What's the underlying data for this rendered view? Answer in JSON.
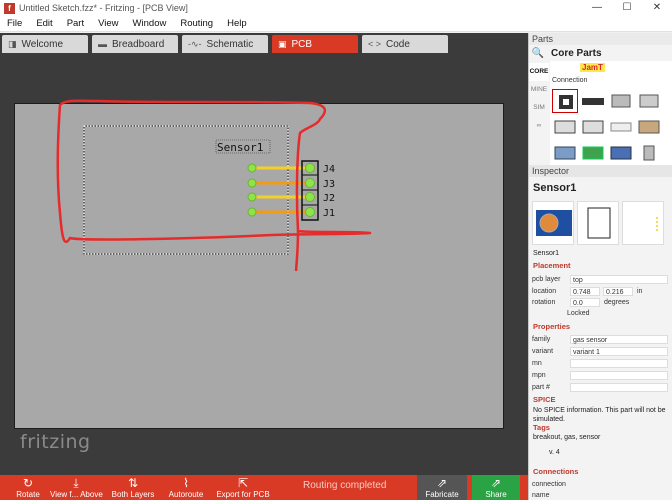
{
  "titlebar": {
    "title": "Untitled Sketch.fzz* - Fritzing - [PCB View]",
    "app_icon": "f",
    "minimize": "—",
    "maximize": "☐",
    "close": "✕"
  },
  "menu": [
    "File",
    "Edit",
    "Part",
    "View",
    "Window",
    "Routing",
    "Help"
  ],
  "tabs": [
    {
      "label": "Welcome",
      "icon": "◨",
      "active": false
    },
    {
      "label": "Breadboard",
      "icon": "▬",
      "active": false
    },
    {
      "label": "Schematic",
      "icon": "-∿-",
      "active": false
    },
    {
      "label": "PCB",
      "icon": "▣",
      "active": true
    },
    {
      "label": "Code",
      "icon": "< >",
      "active": false
    }
  ],
  "pcb": {
    "part_label": "Sensor1",
    "pins": [
      "J4",
      "J3",
      "J2",
      "J1"
    ],
    "trace_colors": [
      "#f2d027",
      "#f39c12",
      "#f2d027",
      "#f39c12"
    ],
    "pad_color": "#8fe34a",
    "board_color": "#a8a8a8",
    "annotation_color": "#e52b2b"
  },
  "logo": "fritzing",
  "toolbar": {
    "rotate": "Rotate",
    "view_from_above": "View f... Above",
    "both_layers": "Both Layers",
    "autoroute": "Autoroute",
    "export_pcb": "Export for PCB",
    "status": "Routing completed",
    "fabricate": "Fabricate",
    "share": "Share"
  },
  "parts": {
    "header": "Parts",
    "bin_title": "Core Parts",
    "bin_tabs": [
      "CORE",
      "MINE",
      "SIM",
      "∞"
    ],
    "section_label": "Connection",
    "jam_label": "JamT"
  },
  "inspector": {
    "header": "Inspector",
    "title": "Sensor1",
    "subtitle": "Sensor1",
    "placement_title": "Placement",
    "pcb_layer_key": "pcb layer",
    "pcb_layer_val": "top",
    "location_key": "location",
    "location_x": "0.748",
    "location_y": "0.216",
    "location_unit": "in",
    "rotation_key": "rotation",
    "rotation_val": "0.0",
    "rotation_unit": "degrees",
    "locked_label": "Locked",
    "properties_title": "Properties",
    "props": [
      {
        "k": "family",
        "v": "gas sensor"
      },
      {
        "k": "variant",
        "v": "variant 1"
      },
      {
        "k": "mn",
        "v": ""
      },
      {
        "k": "mpn",
        "v": ""
      },
      {
        "k": "part #",
        "v": ""
      }
    ],
    "spice_title": "SPICE",
    "spice_text": "No SPICE information. This part will not be simulated.",
    "tags_title": "Tags",
    "tags_text": "breakout, gas, sensor",
    "version": "v. 4",
    "connections_title": "Connections",
    "conn_key": "connection",
    "name_key": "name"
  }
}
